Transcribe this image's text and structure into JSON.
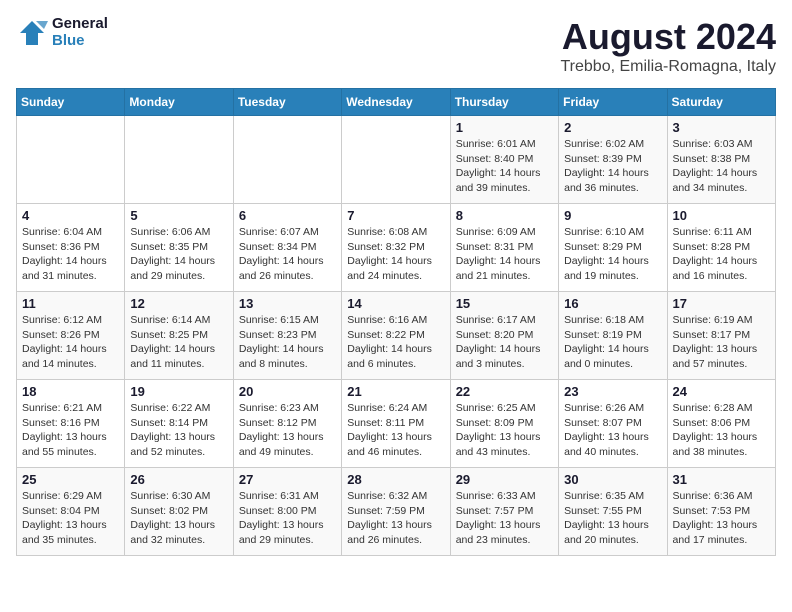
{
  "header": {
    "logo_line1": "General",
    "logo_line2": "Blue",
    "main_title": "August 2024",
    "subtitle": "Trebbo, Emilia-Romagna, Italy"
  },
  "calendar": {
    "days_of_week": [
      "Sunday",
      "Monday",
      "Tuesday",
      "Wednesday",
      "Thursday",
      "Friday",
      "Saturday"
    ],
    "weeks": [
      [
        {
          "day": "",
          "info": ""
        },
        {
          "day": "",
          "info": ""
        },
        {
          "day": "",
          "info": ""
        },
        {
          "day": "",
          "info": ""
        },
        {
          "day": "1",
          "info": "Sunrise: 6:01 AM\nSunset: 8:40 PM\nDaylight: 14 hours\nand 39 minutes."
        },
        {
          "day": "2",
          "info": "Sunrise: 6:02 AM\nSunset: 8:39 PM\nDaylight: 14 hours\nand 36 minutes."
        },
        {
          "day": "3",
          "info": "Sunrise: 6:03 AM\nSunset: 8:38 PM\nDaylight: 14 hours\nand 34 minutes."
        }
      ],
      [
        {
          "day": "4",
          "info": "Sunrise: 6:04 AM\nSunset: 8:36 PM\nDaylight: 14 hours\nand 31 minutes."
        },
        {
          "day": "5",
          "info": "Sunrise: 6:06 AM\nSunset: 8:35 PM\nDaylight: 14 hours\nand 29 minutes."
        },
        {
          "day": "6",
          "info": "Sunrise: 6:07 AM\nSunset: 8:34 PM\nDaylight: 14 hours\nand 26 minutes."
        },
        {
          "day": "7",
          "info": "Sunrise: 6:08 AM\nSunset: 8:32 PM\nDaylight: 14 hours\nand 24 minutes."
        },
        {
          "day": "8",
          "info": "Sunrise: 6:09 AM\nSunset: 8:31 PM\nDaylight: 14 hours\nand 21 minutes."
        },
        {
          "day": "9",
          "info": "Sunrise: 6:10 AM\nSunset: 8:29 PM\nDaylight: 14 hours\nand 19 minutes."
        },
        {
          "day": "10",
          "info": "Sunrise: 6:11 AM\nSunset: 8:28 PM\nDaylight: 14 hours\nand 16 minutes."
        }
      ],
      [
        {
          "day": "11",
          "info": "Sunrise: 6:12 AM\nSunset: 8:26 PM\nDaylight: 14 hours\nand 14 minutes."
        },
        {
          "day": "12",
          "info": "Sunrise: 6:14 AM\nSunset: 8:25 PM\nDaylight: 14 hours\nand 11 minutes."
        },
        {
          "day": "13",
          "info": "Sunrise: 6:15 AM\nSunset: 8:23 PM\nDaylight: 14 hours\nand 8 minutes."
        },
        {
          "day": "14",
          "info": "Sunrise: 6:16 AM\nSunset: 8:22 PM\nDaylight: 14 hours\nand 6 minutes."
        },
        {
          "day": "15",
          "info": "Sunrise: 6:17 AM\nSunset: 8:20 PM\nDaylight: 14 hours\nand 3 minutes."
        },
        {
          "day": "16",
          "info": "Sunrise: 6:18 AM\nSunset: 8:19 PM\nDaylight: 14 hours\nand 0 minutes."
        },
        {
          "day": "17",
          "info": "Sunrise: 6:19 AM\nSunset: 8:17 PM\nDaylight: 13 hours\nand 57 minutes."
        }
      ],
      [
        {
          "day": "18",
          "info": "Sunrise: 6:21 AM\nSunset: 8:16 PM\nDaylight: 13 hours\nand 55 minutes."
        },
        {
          "day": "19",
          "info": "Sunrise: 6:22 AM\nSunset: 8:14 PM\nDaylight: 13 hours\nand 52 minutes."
        },
        {
          "day": "20",
          "info": "Sunrise: 6:23 AM\nSunset: 8:12 PM\nDaylight: 13 hours\nand 49 minutes."
        },
        {
          "day": "21",
          "info": "Sunrise: 6:24 AM\nSunset: 8:11 PM\nDaylight: 13 hours\nand 46 minutes."
        },
        {
          "day": "22",
          "info": "Sunrise: 6:25 AM\nSunset: 8:09 PM\nDaylight: 13 hours\nand 43 minutes."
        },
        {
          "day": "23",
          "info": "Sunrise: 6:26 AM\nSunset: 8:07 PM\nDaylight: 13 hours\nand 40 minutes."
        },
        {
          "day": "24",
          "info": "Sunrise: 6:28 AM\nSunset: 8:06 PM\nDaylight: 13 hours\nand 38 minutes."
        }
      ],
      [
        {
          "day": "25",
          "info": "Sunrise: 6:29 AM\nSunset: 8:04 PM\nDaylight: 13 hours\nand 35 minutes."
        },
        {
          "day": "26",
          "info": "Sunrise: 6:30 AM\nSunset: 8:02 PM\nDaylight: 13 hours\nand 32 minutes."
        },
        {
          "day": "27",
          "info": "Sunrise: 6:31 AM\nSunset: 8:00 PM\nDaylight: 13 hours\nand 29 minutes."
        },
        {
          "day": "28",
          "info": "Sunrise: 6:32 AM\nSunset: 7:59 PM\nDaylight: 13 hours\nand 26 minutes."
        },
        {
          "day": "29",
          "info": "Sunrise: 6:33 AM\nSunset: 7:57 PM\nDaylight: 13 hours\nand 23 minutes."
        },
        {
          "day": "30",
          "info": "Sunrise: 6:35 AM\nSunset: 7:55 PM\nDaylight: 13 hours\nand 20 minutes."
        },
        {
          "day": "31",
          "info": "Sunrise: 6:36 AM\nSunset: 7:53 PM\nDaylight: 13 hours\nand 17 minutes."
        }
      ]
    ]
  }
}
